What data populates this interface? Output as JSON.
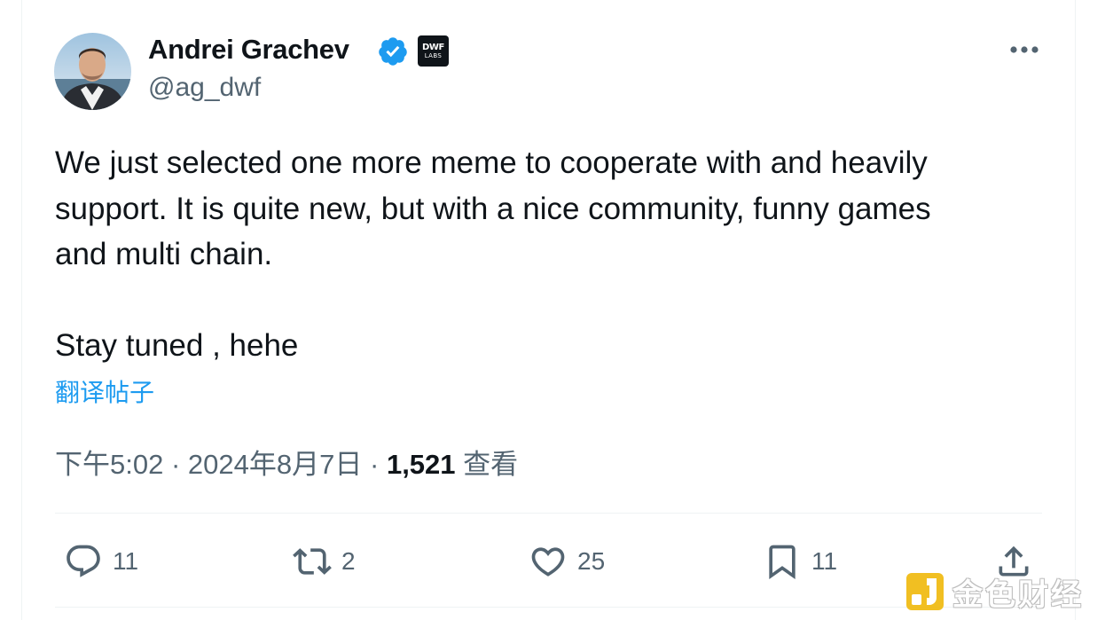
{
  "author": {
    "name": "Andrei Grachev",
    "handle": "@ag_dwf",
    "org_badge": {
      "line1": "DWF",
      "line2": "LABS"
    }
  },
  "tweet": {
    "lines": [
      "We just selected one more meme to cooperate with and heavily",
      "support. It is quite new, but with a nice community, funny games",
      "and multi chain."
    ],
    "closing": "Stay tuned , hehe",
    "translate_label": "翻译帖子",
    "time": "下午5:02",
    "separator": "·",
    "date": "2024年8月7日",
    "views_count": "1,521",
    "views_label": "查看"
  },
  "actions": {
    "reply_count": "11",
    "retweet_count": "2",
    "like_count": "25",
    "bookmark_count": "11"
  },
  "watermark": {
    "text": "金色财经"
  },
  "colors": {
    "text": "#0f1419",
    "secondary": "#536471",
    "link": "#1d9bf0",
    "verified": "#1d9bf0",
    "divider": "#eff3f4",
    "watermark_logo": "#f0b90b"
  }
}
